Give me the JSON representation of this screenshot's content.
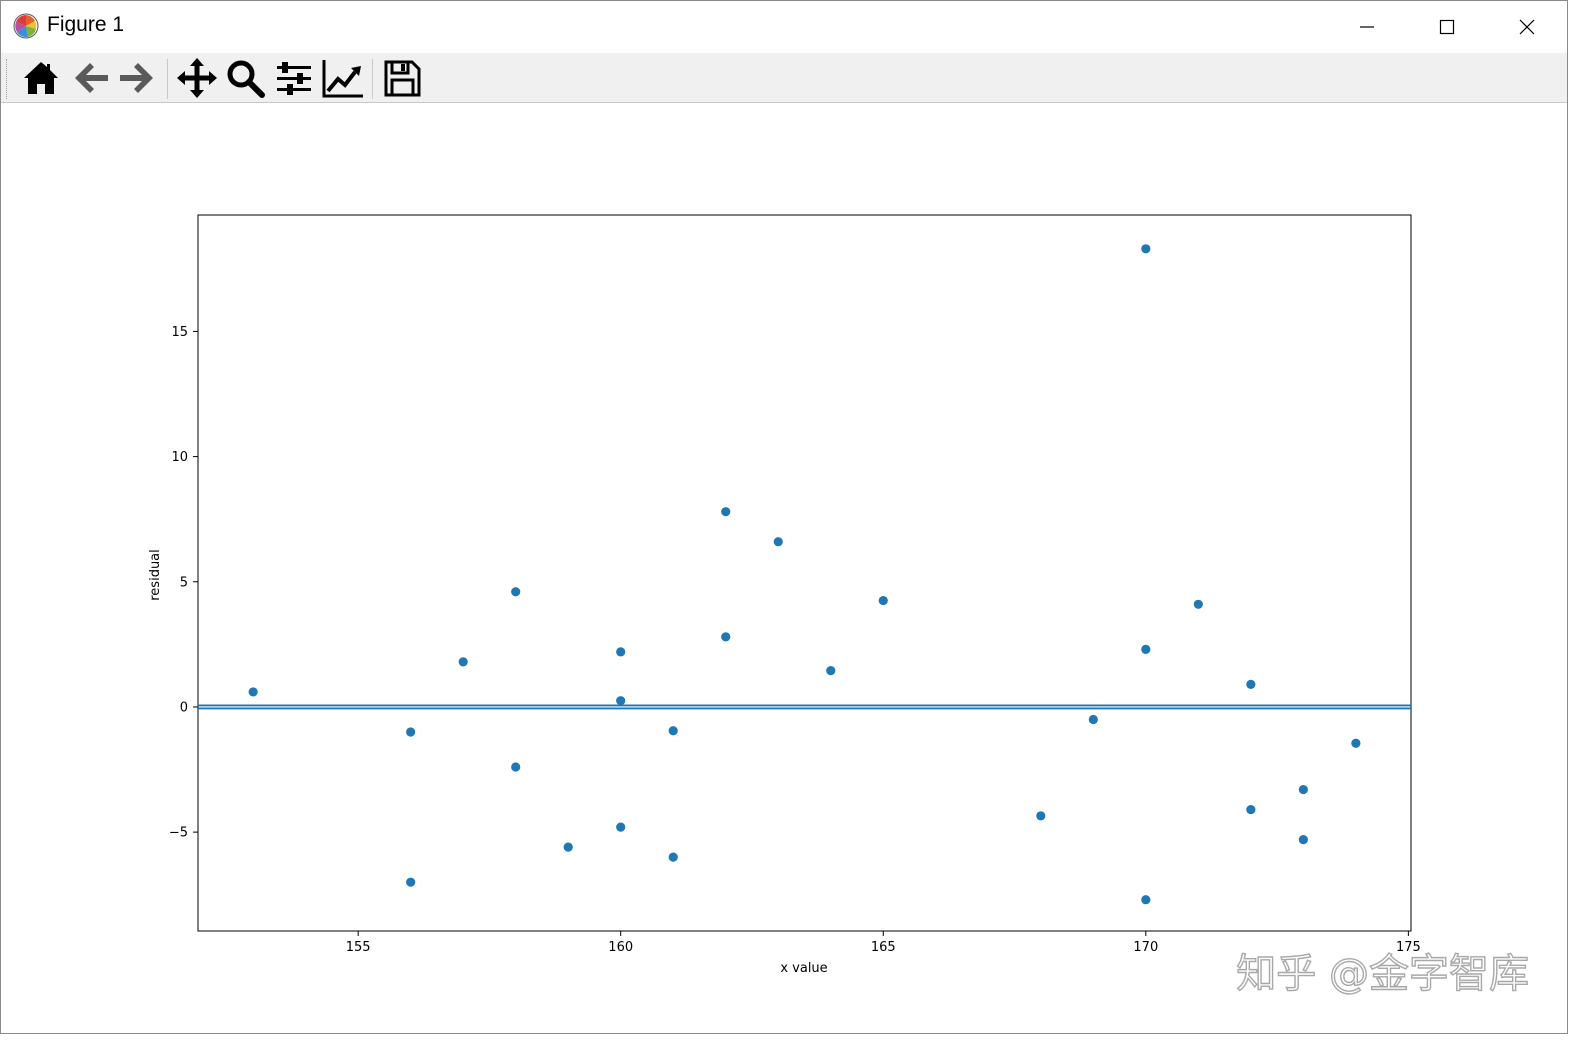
{
  "window": {
    "title": "Figure 1",
    "controls": [
      "minimize-icon",
      "maximize-icon",
      "close-icon"
    ]
  },
  "toolbar": {
    "buttons": [
      {
        "icon": "home-icon",
        "tooltip": "Reset original view"
      },
      {
        "icon": "back-arrow-icon",
        "tooltip": "Back to previous view"
      },
      {
        "icon": "forward-arrow-icon",
        "tooltip": "Forward to next view"
      },
      {
        "icon": "pan-move-icon",
        "tooltip": "Pan axes"
      },
      {
        "icon": "zoom-icon",
        "tooltip": "Zoom to rectangle"
      },
      {
        "icon": "subplots-config-icon",
        "tooltip": "Configure subplots"
      },
      {
        "icon": "edit-axis-icon",
        "tooltip": "Edit axis"
      },
      {
        "icon": "save-icon",
        "tooltip": "Save the figure"
      }
    ]
  },
  "chart_data": {
    "type": "scatter",
    "title": "",
    "xlabel": "x value",
    "ylabel": "residual",
    "xlim": [
      151.95,
      175.05
    ],
    "ylim": [
      -8.95,
      19.65
    ],
    "xticks": [
      155,
      160,
      165,
      170,
      175
    ],
    "yticks": [
      -5,
      0,
      5,
      10,
      15
    ],
    "grid": false,
    "point_color": "#1f77b4",
    "reference_line": {
      "y": 0,
      "color": "#1f77b4"
    },
    "points": [
      {
        "x": 153,
        "y": 0.6
      },
      {
        "x": 156,
        "y": -1.0
      },
      {
        "x": 156,
        "y": -7.0
      },
      {
        "x": 157,
        "y": 1.8
      },
      {
        "x": 158,
        "y": 4.6
      },
      {
        "x": 158,
        "y": -2.4
      },
      {
        "x": 159,
        "y": -5.6
      },
      {
        "x": 160,
        "y": 2.2
      },
      {
        "x": 160,
        "y": 0.25
      },
      {
        "x": 160,
        "y": -4.8
      },
      {
        "x": 161,
        "y": -0.95
      },
      {
        "x": 161,
        "y": -6.0
      },
      {
        "x": 162,
        "y": 7.8
      },
      {
        "x": 162,
        "y": 2.8
      },
      {
        "x": 163,
        "y": 6.6
      },
      {
        "x": 164,
        "y": 1.45
      },
      {
        "x": 165,
        "y": 4.25
      },
      {
        "x": 168,
        "y": -4.35
      },
      {
        "x": 169,
        "y": -0.5
      },
      {
        "x": 170,
        "y": 18.3
      },
      {
        "x": 170,
        "y": 2.3
      },
      {
        "x": 170,
        "y": -7.7
      },
      {
        "x": 171,
        "y": 4.1
      },
      {
        "x": 172,
        "y": 0.9
      },
      {
        "x": 172,
        "y": -4.1
      },
      {
        "x": 173,
        "y": -3.3
      },
      {
        "x": 173,
        "y": -5.3
      },
      {
        "x": 174,
        "y": -1.45
      }
    ]
  },
  "watermark": "知乎 @金字智库"
}
